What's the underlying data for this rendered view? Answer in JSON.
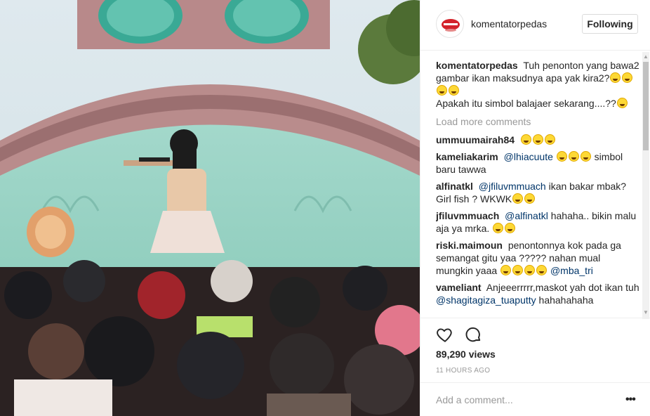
{
  "post": {
    "username": "komentatorpedas",
    "follow_label": "Following"
  },
  "caption": {
    "user": "komentatorpedas",
    "line1": "Tuh penonton yang bawa2 gambar ikan maksudnya apa yak kira2?",
    "line2": "Apakah itu simbol balajaer sekarang....??"
  },
  "load_more": "Load more comments",
  "comments": [
    {
      "user": "ummuumairah84",
      "pre": "",
      "mention": "",
      "post": ""
    },
    {
      "user": "kameliakarim",
      "pre": "",
      "mention": "@lhiacuute",
      "post": "simbol baru tawwa"
    },
    {
      "user": "alfinatkl",
      "pre": "",
      "mention": "@jfiluvmmuach",
      "post": "ikan bakar mbak? Girl fish ? WKWK"
    },
    {
      "user": "jfiluvmmuach",
      "pre": "",
      "mention": "@alfinatkl",
      "post": "hahaha.. bikin malu aja ya mrka."
    },
    {
      "user": "riski.maimoun",
      "pre": "penontonnya kok pada ga semangat gitu yaa ????? nahan mual mungkin yaaa",
      "mention": "@mba_tri",
      "post": ""
    },
    {
      "user": "vameliant",
      "pre": "Anjeeerrrrr,maskot yah dot ikan tuh",
      "mention": "@shagitagiza_tuaputty",
      "post": "hahahahaha"
    }
  ],
  "views": "89,290 views",
  "timestamp": "11 HOURS AGO",
  "add_comment_placeholder": "Add a comment...",
  "icons": {
    "like": "heart-outline-icon",
    "comment": "speech-bubble-icon",
    "more": "ellipsis-icon"
  },
  "colors": {
    "link": "#003569",
    "muted": "#999999",
    "text": "#262626",
    "border": "#efefef"
  }
}
